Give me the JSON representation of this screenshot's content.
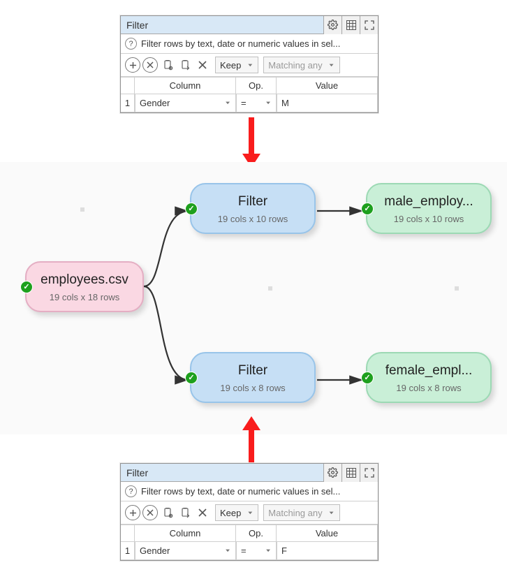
{
  "panel": {
    "title": "Filter",
    "help_text": "Filter rows by text, date or numeric values in sel...",
    "keep_label": "Keep",
    "match_label": "Matching any",
    "headers": {
      "col": "Column",
      "op": "Op.",
      "val": "Value"
    },
    "row": {
      "num": "1",
      "column": "Gender",
      "op": "="
    },
    "value_top": "M",
    "value_bottom": "F"
  },
  "nodes": {
    "employees": {
      "title": "employees.csv",
      "subtitle": "19 cols x 18 rows"
    },
    "filter1": {
      "title": "Filter",
      "subtitle": "19 cols x 10 rows"
    },
    "filter2": {
      "title": "Filter",
      "subtitle": "19 cols x 8 rows"
    },
    "male": {
      "title": "male_employ...",
      "subtitle": "19 cols x 10 rows"
    },
    "female": {
      "title": "female_empl...",
      "subtitle": "19 cols x 8 rows"
    }
  }
}
